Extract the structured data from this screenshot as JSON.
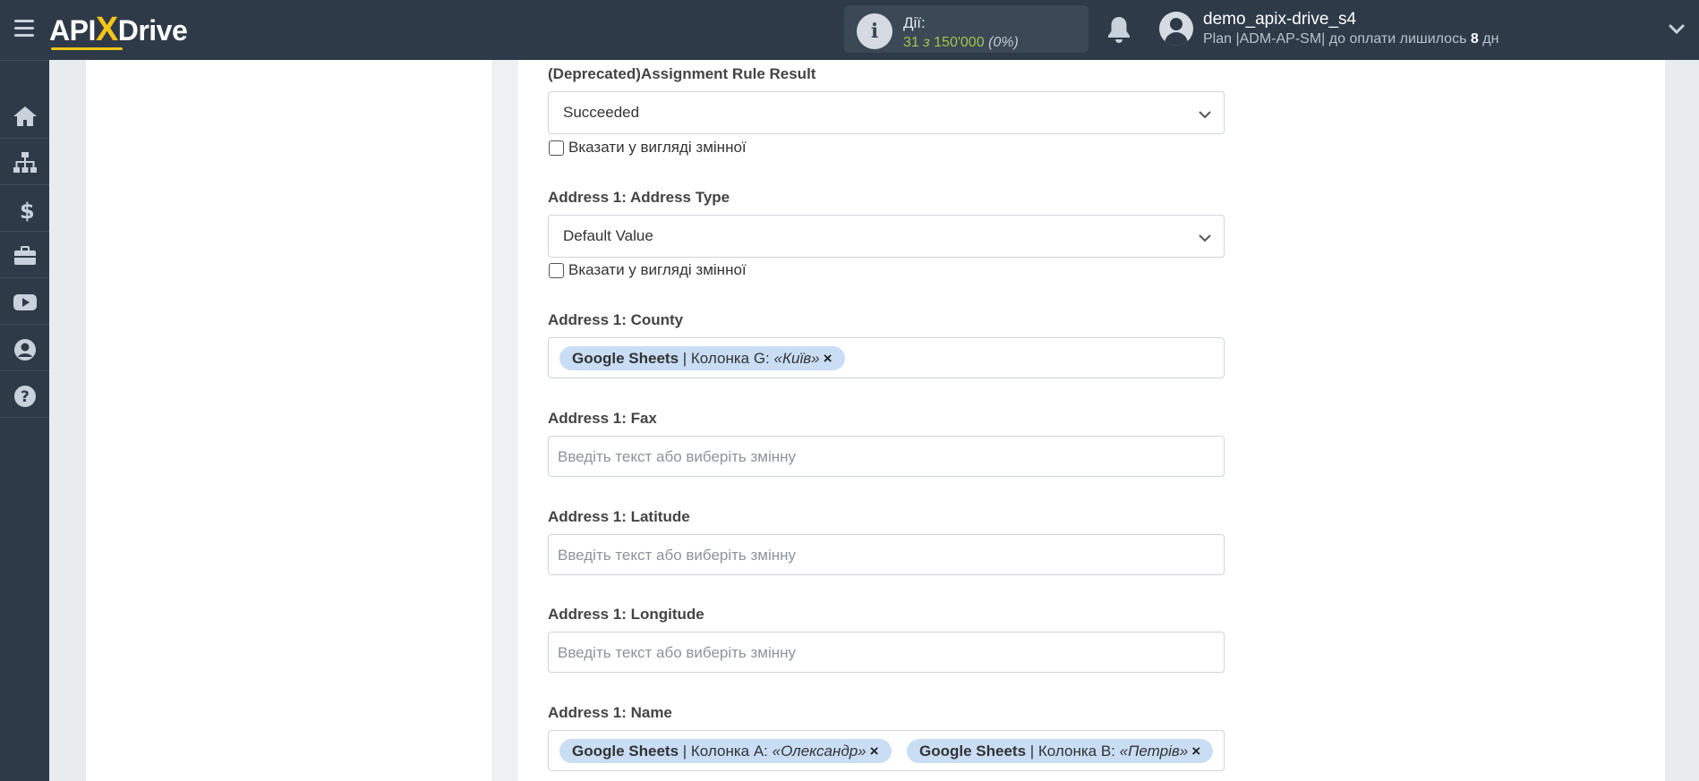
{
  "header": {
    "logo_api": "API",
    "logo_x": "X",
    "logo_drive": "Drive",
    "actions_title": "Дії:",
    "actions_used": "31",
    "actions_of": "з",
    "actions_total": "150'000",
    "actions_pct": "(0%)",
    "user_name": "demo_apix-drive_s4",
    "user_plan_prefix": "Plan |ADM-AP-SM| до оплати лишилось",
    "user_plan_days": "8",
    "user_plan_unit": "дн"
  },
  "sidebar": {
    "items": [
      {
        "icon": "home-icon"
      },
      {
        "icon": "sitemap-icon"
      },
      {
        "icon": "dollar-icon"
      },
      {
        "icon": "briefcase-icon"
      },
      {
        "icon": "youtube-icon"
      },
      {
        "icon": "user-circle-icon"
      },
      {
        "icon": "help-icon"
      }
    ]
  },
  "form": {
    "assignment_rule": {
      "label": "(Deprecated)Assignment Rule Result",
      "value": "Succeeded",
      "checkbox_label": "Вказати у вигляді змінної"
    },
    "address_type": {
      "label": "Address 1: Address Type",
      "value": "Default Value",
      "checkbox_label": "Вказати у вигляді змінної"
    },
    "county": {
      "label": "Address 1: County",
      "tags": [
        {
          "source": "Google Sheets",
          "column": "| Колонка G:",
          "value": "«Київ»",
          "remove": "×"
        }
      ]
    },
    "fax": {
      "label": "Address 1: Fax",
      "placeholder": "Введіть текст або виберіть змінну"
    },
    "latitude": {
      "label": "Address 1: Latitude",
      "placeholder": "Введіть текст або виберіть змінну"
    },
    "longitude": {
      "label": "Address 1: Longitude",
      "placeholder": "Введіть текст або виберіть змінну"
    },
    "name": {
      "label": "Address 1: Name",
      "tags": [
        {
          "source": "Google Sheets",
          "column": "| Колонка A:",
          "value": "«Олександр»",
          "remove": "×"
        },
        {
          "source": "Google Sheets",
          "column": "| Колонка B:",
          "value": "«Петрів»",
          "remove": "×"
        }
      ]
    }
  },
  "colors": {
    "header_bg": "#2e3a48",
    "accent_yellow": "#f5c518",
    "actions_green": "#9ec64a",
    "tag_bg": "#c9def5"
  }
}
